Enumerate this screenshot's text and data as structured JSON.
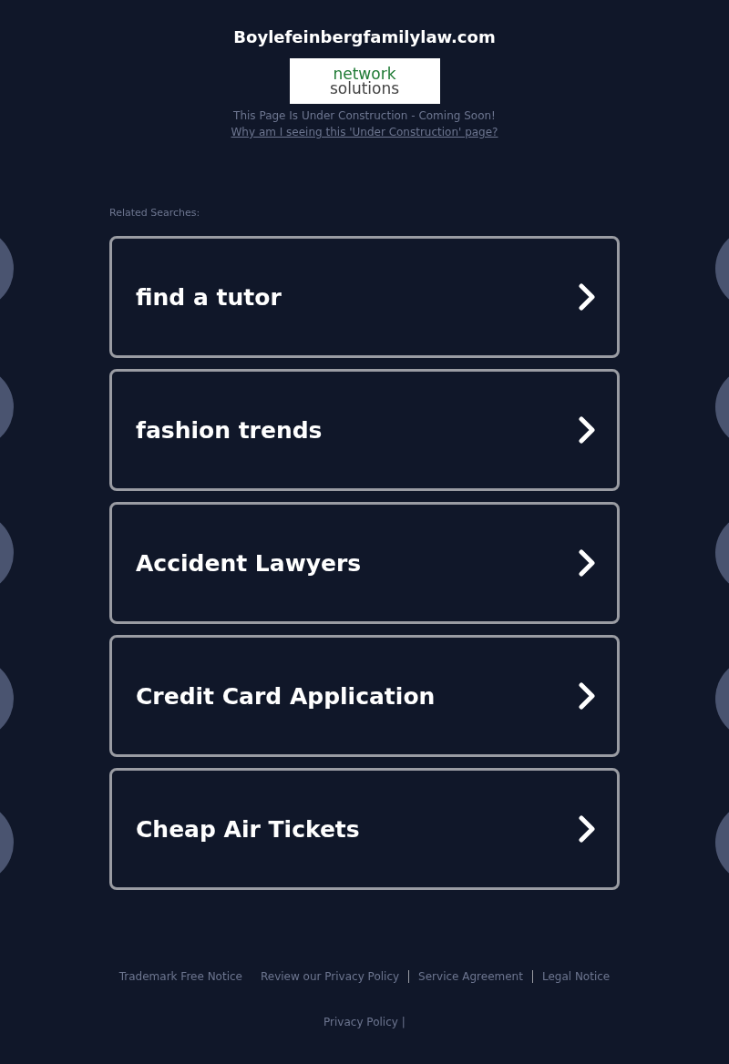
{
  "site_title": "Boylefeinbergfamilylaw.com",
  "logo": {
    "line_1": "network",
    "line_2": "solutions"
  },
  "notice": "This Page Is Under Construction - Coming Soon!",
  "why_link": "Why am I seeing this 'Under Construction' page?",
  "related_label": "Related Searches:",
  "searches": [
    {
      "label": "find a tutor"
    },
    {
      "label": "fashion trends"
    },
    {
      "label": "Accident Lawyers"
    },
    {
      "label": "Credit Card Application"
    },
    {
      "label": "Cheap Air Tickets"
    }
  ],
  "footer_links": [
    "Trademark Free Notice",
    "Review our Privacy Policy",
    "Service Agreement",
    "Legal Notice"
  ],
  "privacy_policy": "Privacy Policy",
  "privacy_separator": "|"
}
